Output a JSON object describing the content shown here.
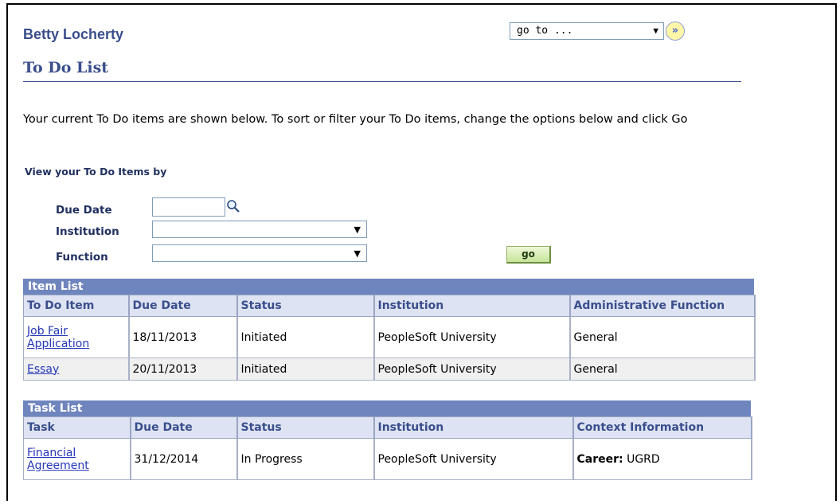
{
  "header": {
    "user_name": "Betty Locherty",
    "goto_value": "go to ...",
    "goto_button_icon": "double-chevron-right-icon"
  },
  "page": {
    "title": "To Do List",
    "intro": "Your current To Do items are shown below. To sort or filter your To Do items, change the options below and click Go"
  },
  "filters": {
    "heading": "View your To Do Items by",
    "due_date_label": "Due Date",
    "due_date_value": "",
    "institution_label": "Institution",
    "institution_value": "",
    "function_label": "Function",
    "function_value": "",
    "go_label": "go"
  },
  "item_list": {
    "title": "Item List",
    "columns": [
      "To Do Item",
      "Due Date",
      "Status",
      "Institution",
      "Administrative Function"
    ],
    "rows": [
      [
        "Job Fair Application",
        "18/11/2013",
        "Initiated",
        "PeopleSoft University",
        "General"
      ],
      [
        "Essay",
        "20/11/2013",
        "Initiated",
        "PeopleSoft University",
        "General"
      ]
    ]
  },
  "task_list": {
    "title": "Task List",
    "columns": [
      "Task",
      "Due Date",
      "Status",
      "Institution",
      "Context Information"
    ],
    "rows": [
      [
        "Financial Agreement",
        "31/12/2014",
        "In Progress",
        "PeopleSoft University",
        "UGRD"
      ]
    ],
    "context_key": "Career:"
  }
}
